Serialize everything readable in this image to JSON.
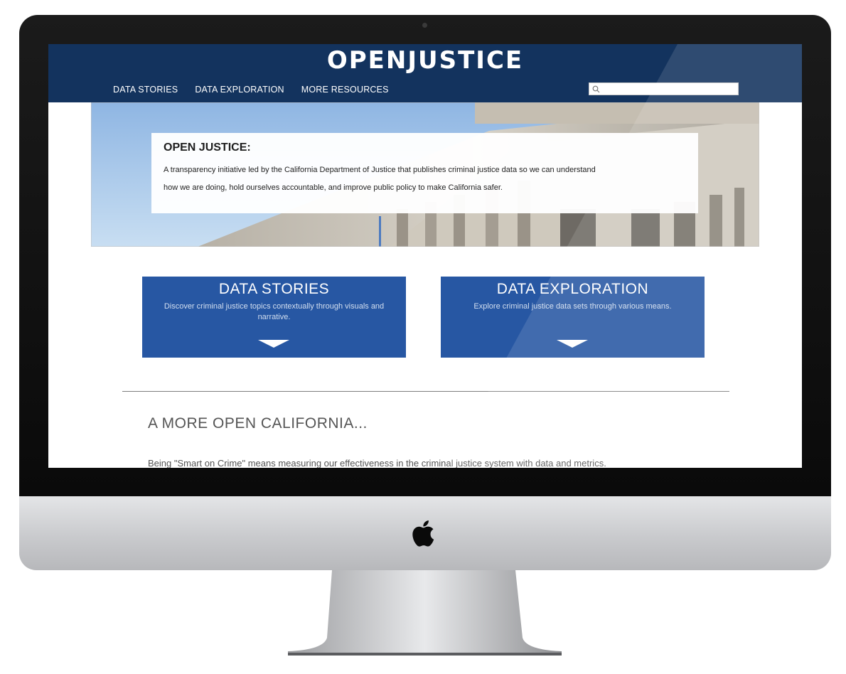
{
  "site": {
    "logo": "OPENJUSTICE",
    "nav": [
      "DATA STORIES",
      "DATA EXPLORATION",
      "MORE RESOURCES"
    ],
    "search": {
      "value": "",
      "placeholder": ""
    }
  },
  "hero": {
    "title": "OPEN JUSTICE:",
    "line1": "A transparency initiative led by the California Department of Justice that publishes criminal justice data so we can understand",
    "line2": "how we are doing, hold ourselves accountable, and improve public policy to make California safer."
  },
  "cards": [
    {
      "title": "DATA STORIES",
      "description": "Discover criminal justice topics contextually through visuals and narrative."
    },
    {
      "title": "DATA EXPLORATION",
      "description": "Explore criminal justice data sets through various means."
    }
  ],
  "section": {
    "heading": "A MORE OPEN CALIFORNIA...",
    "text": "Being \"Smart on Crime\" means measuring our effectiveness in the criminal justice system with data and metrics."
  },
  "colors": {
    "header": "#13335e",
    "card": "#2757a3",
    "hero_sky": "#b6d3ee"
  },
  "icons": [
    "search-icon",
    "chevron-down-icon",
    "apple-logo-icon"
  ]
}
